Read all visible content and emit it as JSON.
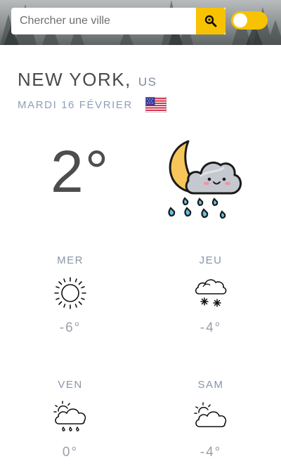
{
  "search": {
    "placeholder": "Chercher une ville",
    "value": ""
  },
  "location": {
    "city": "NEW YORK,",
    "country": "US",
    "date": "MARDI 16 FÉVRIER"
  },
  "current": {
    "temperature": "2°",
    "icon": "moon-cloud-rain-icon"
  },
  "forecast": [
    {
      "day": "MER",
      "temp": "-6°",
      "icon": "sun-icon"
    },
    {
      "day": "JEU",
      "temp": "-4°",
      "icon": "cloud-snow-icon"
    },
    {
      "day": "VEN",
      "temp": "0°",
      "icon": "sun-cloud-rain-icon"
    },
    {
      "day": "SAM",
      "temp": "-4°",
      "icon": "sun-cloud-icon"
    }
  ],
  "colors": {
    "accent": "#f7c200",
    "muted_text": "#8e9fb8"
  }
}
